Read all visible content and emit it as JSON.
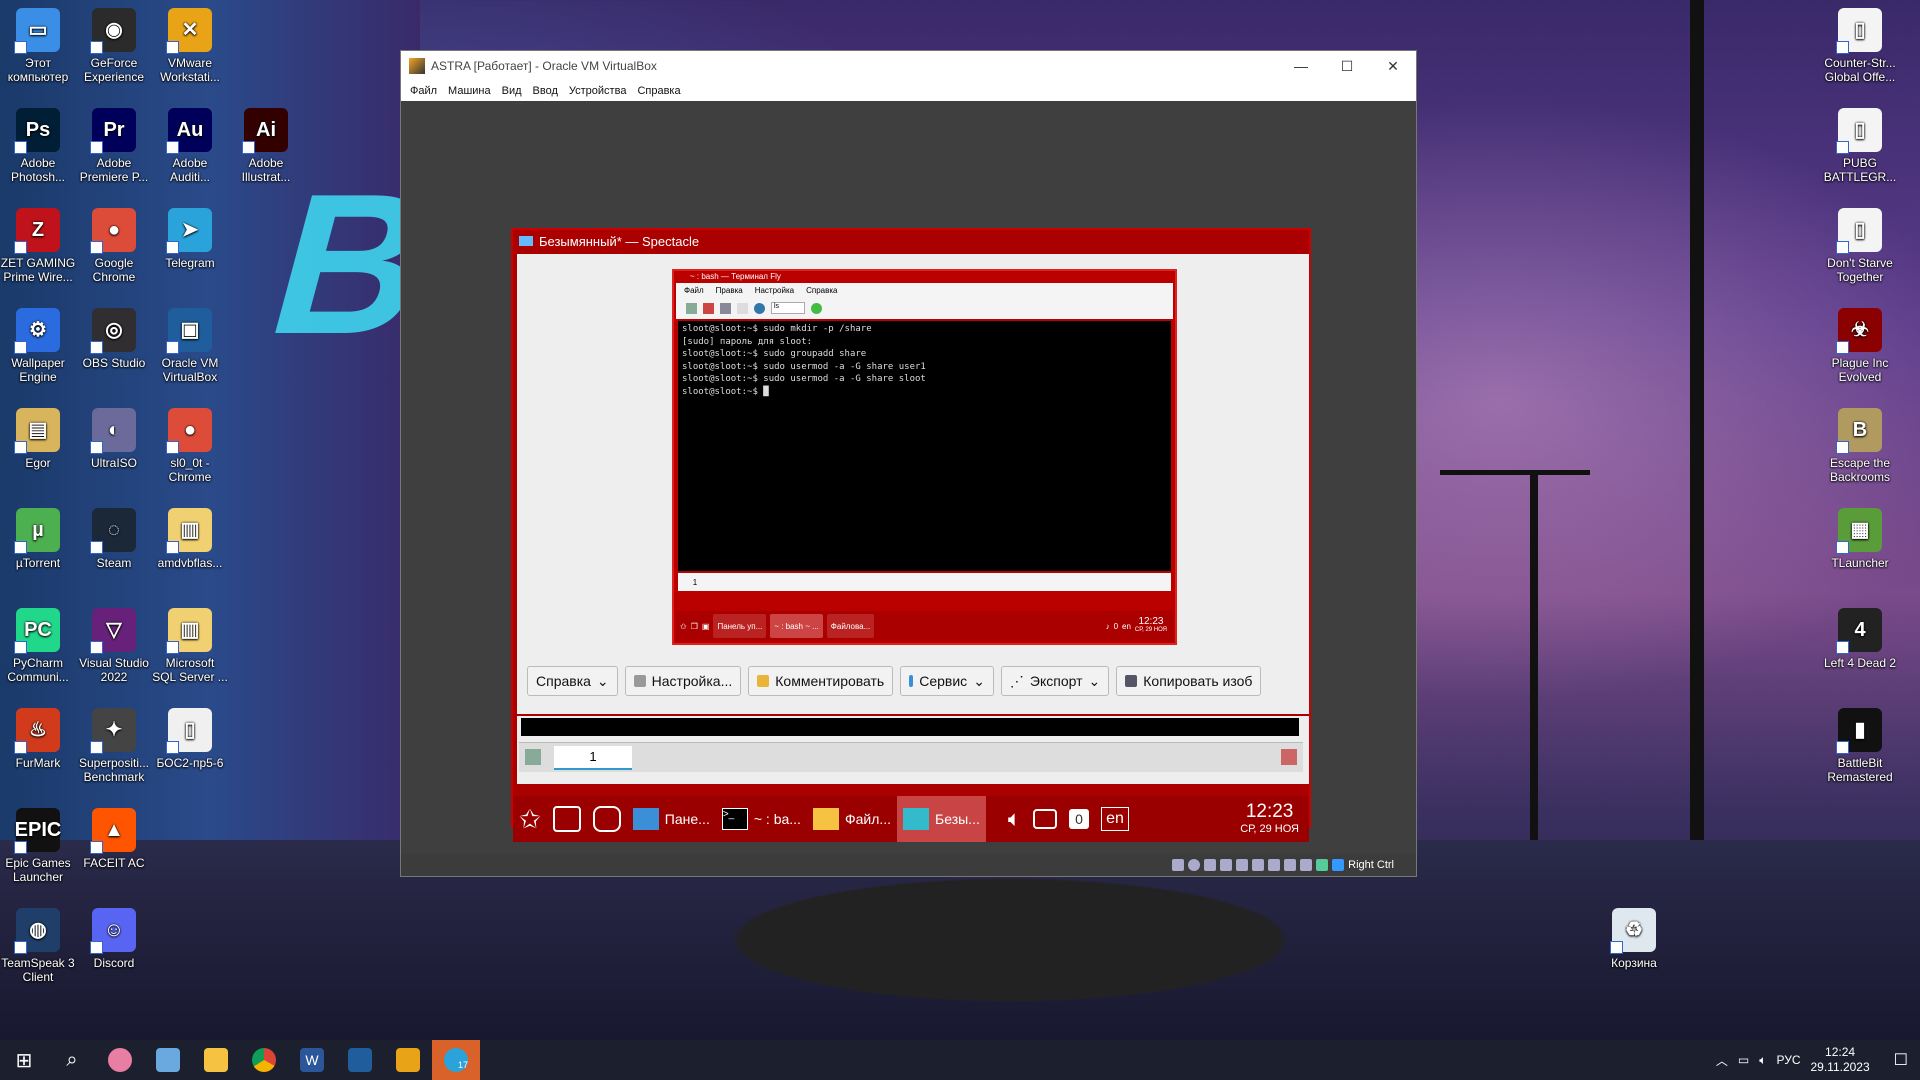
{
  "desktop": {
    "icons_left": [
      {
        "label": "Этот компьютер",
        "color": "#3a8ee6",
        "glyph": "▭"
      },
      {
        "label": "GeForce Experience",
        "color": "#2b2b2b",
        "glyph": "◉"
      },
      {
        "label": "VMware Workstati...",
        "color": "#e8a317",
        "glyph": "✕"
      },
      {
        "label": "Adobe Photosh...",
        "color": "#001e36",
        "glyph": "Ps"
      },
      {
        "label": "Adobe Premiere P...",
        "color": "#00005b",
        "glyph": "Pr"
      },
      {
        "label": "Adobe Auditi...",
        "color": "#00005b",
        "glyph": "Au"
      },
      {
        "label": "Adobe Illustrat...",
        "color": "#330000",
        "glyph": "Ai"
      },
      {
        "label": "ZET GAMING Prime Wire...",
        "color": "#c0121a",
        "glyph": "Z"
      },
      {
        "label": "Google Chrome",
        "color": "#dd4b39",
        "glyph": "●"
      },
      {
        "label": "Telegram",
        "color": "#2aa3db",
        "glyph": "➤"
      },
      {
        "label": "Wallpaper Engine",
        "color": "#2b6be0",
        "glyph": "⚙"
      },
      {
        "label": "OBS Studio",
        "color": "#302e31",
        "glyph": "◎"
      },
      {
        "label": "Oracle VM VirtualBox",
        "color": "#1f5d9c",
        "glyph": "▣"
      },
      {
        "label": "Egor",
        "color": "#d8b45c",
        "glyph": "▤"
      },
      {
        "label": "UltraISO",
        "color": "#6b6b9b",
        "glyph": "◐"
      },
      {
        "label": "sl0_0t - Chrome",
        "color": "#dd4b39",
        "glyph": "●"
      },
      {
        "label": "µTorrent",
        "color": "#4caf50",
        "glyph": "µ"
      },
      {
        "label": "Steam",
        "color": "#1b2838",
        "glyph": "◌"
      },
      {
        "label": "amdvbflas...",
        "color": "#f0d070",
        "glyph": "▥"
      },
      {
        "label": "PyCharm Communi...",
        "color": "#21d789",
        "glyph": "PC"
      },
      {
        "label": "Visual Studio 2022",
        "color": "#68217a",
        "glyph": "▽"
      },
      {
        "label": "Microsoft SQL Server ...",
        "color": "#f0d070",
        "glyph": "▥"
      },
      {
        "label": "FurMark",
        "color": "#d13b1b",
        "glyph": "♨"
      },
      {
        "label": "Superpositi... Benchmark",
        "color": "#444",
        "glyph": "✦"
      },
      {
        "label": "БОС2-пр5-6",
        "color": "#f0f0f0",
        "glyph": "▯"
      },
      {
        "label": "Epic Games Launcher",
        "color": "#111",
        "glyph": "EPIC"
      },
      {
        "label": "FACEIT AC",
        "color": "#ff5500",
        "glyph": "▲"
      },
      {
        "label": "TeamSpeak 3 Client",
        "color": "#1f3f6a",
        "glyph": "◍"
      },
      {
        "label": "Discord",
        "color": "#5865f2",
        "glyph": "☺"
      }
    ],
    "icons_right": [
      {
        "label": "Counter-Str... Global Offe...",
        "color": "#f4f4f4",
        "glyph": "▯"
      },
      {
        "label": "PUBG BATTLEGR...",
        "color": "#f4f4f4",
        "glyph": "▯"
      },
      {
        "label": "Don't Starve Together",
        "color": "#f4f4f4",
        "glyph": "▯"
      },
      {
        "label": "Plague Inc Evolved",
        "color": "#8b0000",
        "glyph": "☣"
      },
      {
        "label": "Escape the Backrooms",
        "color": "#b09a60",
        "glyph": "B"
      },
      {
        "label": "TLauncher",
        "color": "#5a9b3a",
        "glyph": "▦"
      },
      {
        "label": "Left 4 Dead 2",
        "color": "#222",
        "glyph": "4"
      },
      {
        "label": "BattleBit Remastered",
        "color": "#111",
        "glyph": "▮"
      },
      {
        "label": "Корзина",
        "color": "#dfe7ef",
        "glyph": "♻"
      }
    ]
  },
  "vbox": {
    "title": "ASTRA [Работает] - Oracle VM VirtualBox",
    "menu": [
      "Файл",
      "Машина",
      "Вид",
      "Ввод",
      "Устройства",
      "Справка"
    ],
    "host_key": "Right Ctrl"
  },
  "spectacle": {
    "title": "Безымянный* — Spectacle",
    "buttons": [
      "Справка",
      "Настройка...",
      "Комментировать",
      "Сервис",
      "Экспорт",
      "Копировать изоб"
    ],
    "tab": "1"
  },
  "preview": {
    "title": "~ : bash — Терминал Fly",
    "menu": [
      "Файл",
      "Правка",
      "Настройка",
      "Справка"
    ],
    "combo": "ls",
    "terminal": "sloot@sloot:~$ sudo mkdir -p /share\n[sudo] пароль для sloot:\nsloot@sloot:~$ sudo groupadd share\nsloot@sloot:~$ sudo usermod -a -G share user1\nsloot@sloot:~$ sudo usermod -a -G share sloot\nsloot@sloot:~$ █",
    "tab": "1",
    "tasks": [
      "Панель уп...",
      "~ : bash ~ ...",
      "Файлова..."
    ],
    "lang": "en",
    "count": "0",
    "time": "12:23",
    "date": "СР, 29 НОЯ"
  },
  "guest_taskbar": {
    "tasks": [
      "Пане...",
      "~ : ba...",
      "Файл...",
      "Безы..."
    ],
    "count": "0",
    "lang": "en",
    "time": "12:23",
    "date": "СР, 29 НОЯ"
  },
  "taskbar": {
    "lang": "РУС",
    "time": "12:24",
    "date": "29.11.2023",
    "badge": "17"
  }
}
